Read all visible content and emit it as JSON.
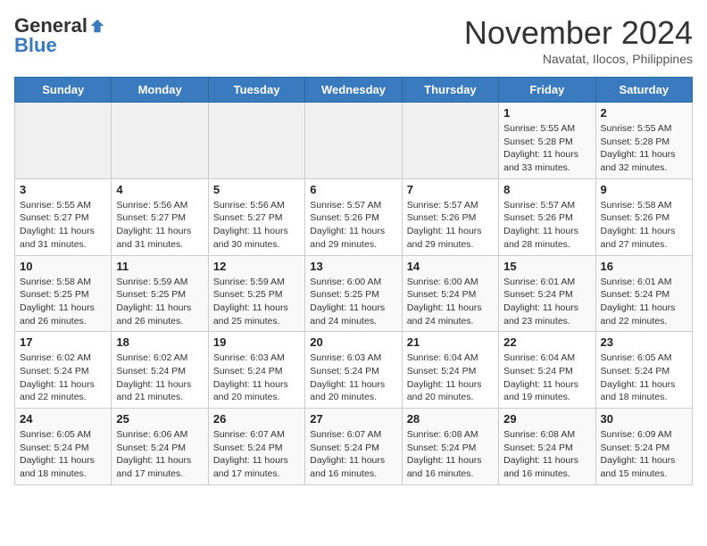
{
  "header": {
    "logo_general": "General",
    "logo_blue": "Blue",
    "month": "November 2024",
    "location": "Navatat, Ilocos, Philippines"
  },
  "days_of_week": [
    "Sunday",
    "Monday",
    "Tuesday",
    "Wednesday",
    "Thursday",
    "Friday",
    "Saturday"
  ],
  "weeks": [
    [
      {
        "day": "",
        "info": ""
      },
      {
        "day": "",
        "info": ""
      },
      {
        "day": "",
        "info": ""
      },
      {
        "day": "",
        "info": ""
      },
      {
        "day": "",
        "info": ""
      },
      {
        "day": "1",
        "info": "Sunrise: 5:55 AM\nSunset: 5:28 PM\nDaylight: 11 hours and 33 minutes."
      },
      {
        "day": "2",
        "info": "Sunrise: 5:55 AM\nSunset: 5:28 PM\nDaylight: 11 hours and 32 minutes."
      }
    ],
    [
      {
        "day": "3",
        "info": "Sunrise: 5:55 AM\nSunset: 5:27 PM\nDaylight: 11 hours and 31 minutes."
      },
      {
        "day": "4",
        "info": "Sunrise: 5:56 AM\nSunset: 5:27 PM\nDaylight: 11 hours and 31 minutes."
      },
      {
        "day": "5",
        "info": "Sunrise: 5:56 AM\nSunset: 5:27 PM\nDaylight: 11 hours and 30 minutes."
      },
      {
        "day": "6",
        "info": "Sunrise: 5:57 AM\nSunset: 5:26 PM\nDaylight: 11 hours and 29 minutes."
      },
      {
        "day": "7",
        "info": "Sunrise: 5:57 AM\nSunset: 5:26 PM\nDaylight: 11 hours and 29 minutes."
      },
      {
        "day": "8",
        "info": "Sunrise: 5:57 AM\nSunset: 5:26 PM\nDaylight: 11 hours and 28 minutes."
      },
      {
        "day": "9",
        "info": "Sunrise: 5:58 AM\nSunset: 5:26 PM\nDaylight: 11 hours and 27 minutes."
      }
    ],
    [
      {
        "day": "10",
        "info": "Sunrise: 5:58 AM\nSunset: 5:25 PM\nDaylight: 11 hours and 26 minutes."
      },
      {
        "day": "11",
        "info": "Sunrise: 5:59 AM\nSunset: 5:25 PM\nDaylight: 11 hours and 26 minutes."
      },
      {
        "day": "12",
        "info": "Sunrise: 5:59 AM\nSunset: 5:25 PM\nDaylight: 11 hours and 25 minutes."
      },
      {
        "day": "13",
        "info": "Sunrise: 6:00 AM\nSunset: 5:25 PM\nDaylight: 11 hours and 24 minutes."
      },
      {
        "day": "14",
        "info": "Sunrise: 6:00 AM\nSunset: 5:24 PM\nDaylight: 11 hours and 24 minutes."
      },
      {
        "day": "15",
        "info": "Sunrise: 6:01 AM\nSunset: 5:24 PM\nDaylight: 11 hours and 23 minutes."
      },
      {
        "day": "16",
        "info": "Sunrise: 6:01 AM\nSunset: 5:24 PM\nDaylight: 11 hours and 22 minutes."
      }
    ],
    [
      {
        "day": "17",
        "info": "Sunrise: 6:02 AM\nSunset: 5:24 PM\nDaylight: 11 hours and 22 minutes."
      },
      {
        "day": "18",
        "info": "Sunrise: 6:02 AM\nSunset: 5:24 PM\nDaylight: 11 hours and 21 minutes."
      },
      {
        "day": "19",
        "info": "Sunrise: 6:03 AM\nSunset: 5:24 PM\nDaylight: 11 hours and 20 minutes."
      },
      {
        "day": "20",
        "info": "Sunrise: 6:03 AM\nSunset: 5:24 PM\nDaylight: 11 hours and 20 minutes."
      },
      {
        "day": "21",
        "info": "Sunrise: 6:04 AM\nSunset: 5:24 PM\nDaylight: 11 hours and 20 minutes."
      },
      {
        "day": "22",
        "info": "Sunrise: 6:04 AM\nSunset: 5:24 PM\nDaylight: 11 hours and 19 minutes."
      },
      {
        "day": "23",
        "info": "Sunrise: 6:05 AM\nSunset: 5:24 PM\nDaylight: 11 hours and 18 minutes."
      }
    ],
    [
      {
        "day": "24",
        "info": "Sunrise: 6:05 AM\nSunset: 5:24 PM\nDaylight: 11 hours and 18 minutes."
      },
      {
        "day": "25",
        "info": "Sunrise: 6:06 AM\nSunset: 5:24 PM\nDaylight: 11 hours and 17 minutes."
      },
      {
        "day": "26",
        "info": "Sunrise: 6:07 AM\nSunset: 5:24 PM\nDaylight: 11 hours and 17 minutes."
      },
      {
        "day": "27",
        "info": "Sunrise: 6:07 AM\nSunset: 5:24 PM\nDaylight: 11 hours and 16 minutes."
      },
      {
        "day": "28",
        "info": "Sunrise: 6:08 AM\nSunset: 5:24 PM\nDaylight: 11 hours and 16 minutes."
      },
      {
        "day": "29",
        "info": "Sunrise: 6:08 AM\nSunset: 5:24 PM\nDaylight: 11 hours and 16 minutes."
      },
      {
        "day": "30",
        "info": "Sunrise: 6:09 AM\nSunset: 5:24 PM\nDaylight: 11 hours and 15 minutes."
      }
    ]
  ]
}
